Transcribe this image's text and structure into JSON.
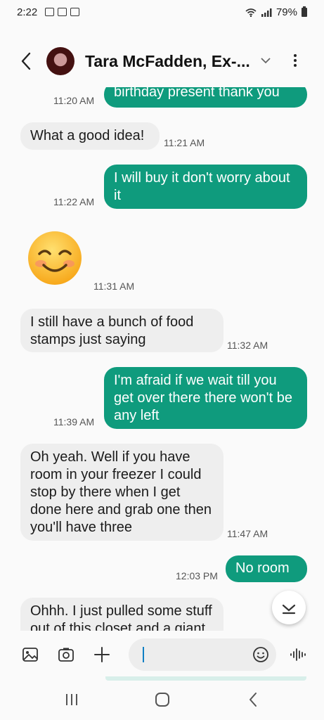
{
  "status_bar": {
    "time": "2:22",
    "battery": "79%"
  },
  "header": {
    "contact_name": "Tara McFadden, Ex-..."
  },
  "messages": [
    {
      "dir": "out",
      "text": "birthday present thank you",
      "time": "11:20 AM"
    },
    {
      "dir": "in",
      "text": "What a good idea!",
      "time": "11:21 AM"
    },
    {
      "dir": "out",
      "text": "I will buy it don't worry about it",
      "time": "11:22 AM"
    },
    {
      "dir": "in",
      "emoji": "smiling-face-emoji",
      "time": "11:31 AM"
    },
    {
      "dir": "in",
      "text": "I still have a bunch of food stamps just saying",
      "time": "11:32 AM"
    },
    {
      "dir": "out",
      "text": "I'm afraid if we wait till you get over there there won't be any left",
      "time": "11:39 AM"
    },
    {
      "dir": "in",
      "text": "Oh yeah. Well if you have room in your freezer I could stop by there when I get done here and grab one then you'll have three",
      "time": "11:47 AM"
    },
    {
      "dir": "out",
      "text": "No room",
      "time": "12:03 PM"
    },
    {
      "dir": "in",
      "text": "Ohhh. I just pulled some stuff out of this closet and a giant rat jump"
    }
  ],
  "compose": {
    "placeholder": ""
  },
  "colors": {
    "outgoing": "#0f9b7d",
    "incoming": "#eeeeee",
    "background": "#fafafa"
  },
  "icons": [
    "back-arrow-icon",
    "chevron-down-icon",
    "more-options-icon",
    "gallery-icon",
    "camera-icon",
    "plus-icon",
    "emoji-icon",
    "voice-record-icon",
    "scroll-down-icon",
    "recents-icon",
    "home-icon",
    "nav-back-icon"
  ]
}
